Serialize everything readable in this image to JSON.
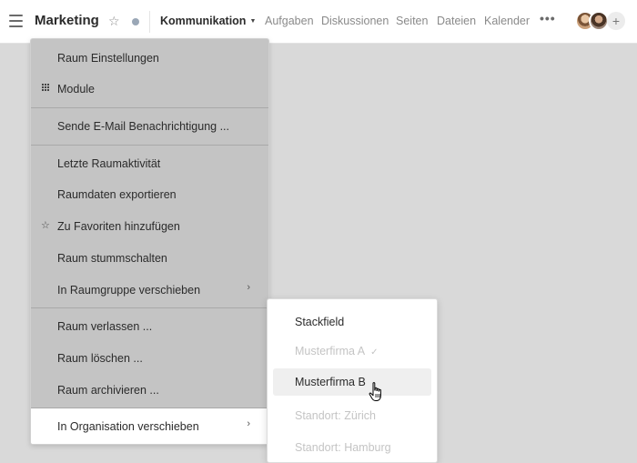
{
  "header": {
    "title": "Marketing",
    "nav": [
      {
        "label": "Kommunikation",
        "active": true
      },
      {
        "label": "Aufgaben"
      },
      {
        "label": "Diskussionen"
      },
      {
        "label": "Seiten"
      },
      {
        "label": "Dateien"
      },
      {
        "label": "Kalender"
      }
    ],
    "more_label": "•••",
    "add_label": "+"
  },
  "menu": {
    "items": [
      {
        "label": "Raum Einstellungen"
      },
      {
        "label": "Module",
        "icon": "grid-icon"
      },
      {
        "label": "Sende E-Mail Benachrichtigung ..."
      },
      {
        "label": "Letzte Raumaktivität"
      },
      {
        "label": "Raumdaten exportieren"
      },
      {
        "label": "Zu Favoriten hinzufügen",
        "icon": "star-icon"
      },
      {
        "label": "Raum stummschalten"
      },
      {
        "label": "In Raumgruppe verschieben",
        "submenu": true
      },
      {
        "label": "Raum verlassen ..."
      },
      {
        "label": "Raum löschen ..."
      },
      {
        "label": "Raum archivieren ..."
      },
      {
        "label": "In Organisation verschieben",
        "submenu": true,
        "highlighted": true
      }
    ]
  },
  "submenu": {
    "items": [
      {
        "label": "Stackfield"
      },
      {
        "label": "Musterfirma A",
        "disabled": true,
        "checked": true
      },
      {
        "label": "Musterfirma B",
        "hovered": true
      },
      {
        "label": "Standort: Zürich",
        "disabled": true
      },
      {
        "label": "Standort: Hamburg",
        "disabled": true
      }
    ]
  },
  "colors": {
    "overlay": "#d9d9d9",
    "menu_bg": "#c4c4c4",
    "submenu_bg": "#ffffff",
    "disabled_text": "#c4c4c4"
  }
}
